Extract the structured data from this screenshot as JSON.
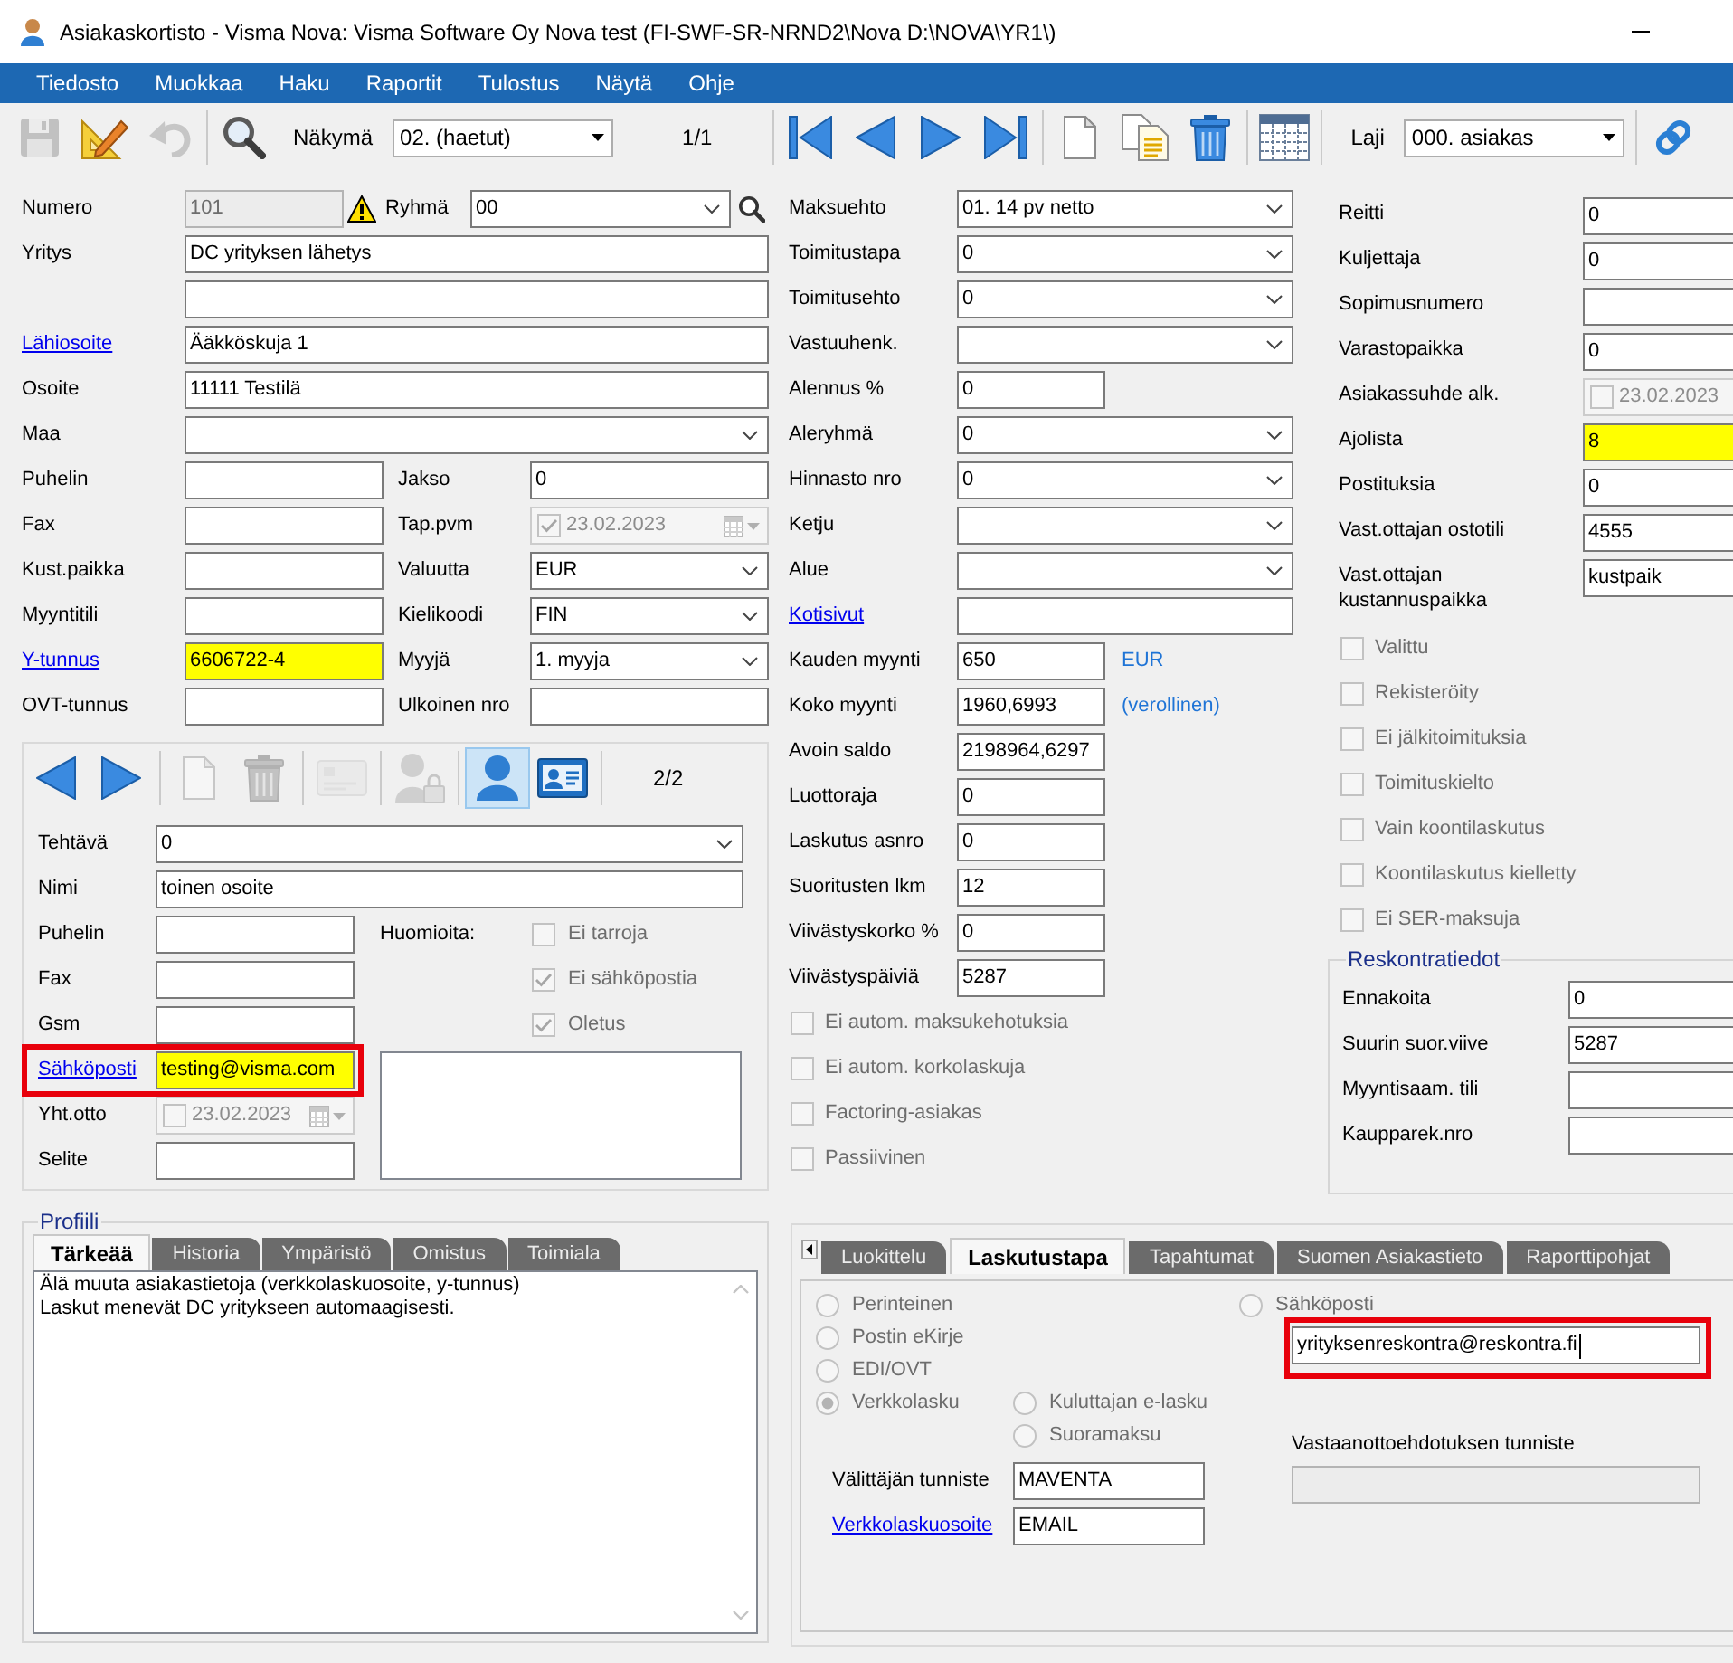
{
  "window": {
    "title": "Asiakaskortisto - Visma Nova: Visma Software Oy Nova test (FI-SWF-SR-NRND2\\Nova D:\\NOVA\\YR1\\)"
  },
  "menu": [
    "Tiedosto",
    "Muokkaa",
    "Haku",
    "Raportit",
    "Tulostus",
    "Näytä",
    "Ohje"
  ],
  "toolbar": [
    [
      {
        "kind": "save",
        "disabled": true
      },
      {
        "kind": "edit",
        "disabled": false
      },
      {
        "kind": "undo",
        "disabled": true
      }
    ],
    [
      {
        "kind": "search",
        "disabled": false
      },
      {
        "kind": "label",
        "text": "Näkymä"
      },
      {
        "kind": "dropdown",
        "value": "02. (haetut)"
      },
      {
        "kind": "counter",
        "text": "1/1"
      }
    ],
    [
      {
        "kind": "first",
        "disabled": false
      },
      {
        "kind": "previous",
        "disabled": false
      },
      {
        "kind": "next",
        "disabled": false
      },
      {
        "kind": "last",
        "disabled": false
      }
    ],
    [
      {
        "kind": "new",
        "disabled": false
      },
      {
        "kind": "copy",
        "disabled": false
      },
      {
        "kind": "delete",
        "disabled": false
      }
    ],
    [
      {
        "kind": "columns",
        "disabled": false
      }
    ],
    [
      {
        "kind": "label",
        "text": "Laji"
      },
      {
        "kind": "dropdown",
        "value": "000. asiakas"
      }
    ],
    [
      {
        "kind": "link",
        "disabled": false
      }
    ]
  ],
  "customer_rows": [
    [
      {
        "label": "Numero",
        "kind": "text",
        "value": "101",
        "disabled": true,
        "warning": true
      },
      {
        "label": "Ryhmä",
        "kind": "dropdown",
        "value": "00",
        "lookup": true
      }
    ],
    [
      {
        "label": "Yritys",
        "kind": "text",
        "value": "DC yrityksen lähetys"
      }
    ],
    [
      {
        "kind": "text"
      }
    ],
    [
      {
        "label": "Lähiosoite",
        "link": true,
        "kind": "text",
        "value": "Ääkköskuja 1"
      }
    ],
    [
      {
        "label": "Osoite",
        "kind": "text",
        "value": "11111 Testilä"
      }
    ],
    [
      {
        "label": "Maa",
        "kind": "dropdown"
      }
    ],
    [
      {
        "label": "Puhelin",
        "kind": "text"
      },
      {
        "label": "Jakso",
        "kind": "text",
        "value": "0"
      }
    ],
    [
      {
        "label": "Fax",
        "kind": "text"
      },
      {
        "label": "Tap.pvm",
        "kind": "date",
        "value": "23.02.2023",
        "checked": true,
        "disabled": true
      }
    ],
    [
      {
        "label": "Kust.paikka",
        "kind": "text"
      },
      {
        "label": "Valuutta",
        "kind": "dropdown",
        "value": "EUR"
      }
    ],
    [
      {
        "label": "Myyntitili",
        "kind": "text"
      },
      {
        "label": "Kielikoodi",
        "kind": "dropdown",
        "value": "FIN"
      }
    ],
    [
      {
        "label": "Y-tunnus",
        "link": true,
        "kind": "text",
        "value": "6606722-4",
        "highlighted": true
      },
      {
        "label": "Myyjä",
        "kind": "dropdown",
        "value": "1. myyja"
      }
    ],
    [
      {
        "label": "OVT-tunnus",
        "kind": "text"
      },
      {
        "label": "Ulkoinen nro",
        "kind": "text"
      }
    ]
  ],
  "contact": {
    "toolbar": [
      [
        {
          "kind": "previous",
          "disabled": false
        },
        {
          "kind": "next",
          "disabled": false
        }
      ],
      [
        {
          "kind": "new",
          "disabled": true
        },
        {
          "kind": "delete",
          "disabled": true
        }
      ],
      [
        {
          "kind": "card",
          "disabled": true
        }
      ],
      [
        {
          "kind": "permissions",
          "disabled": true
        }
      ],
      [
        {
          "kind": "contact",
          "disabled": false,
          "selected": true
        },
        {
          "kind": "vcard",
          "disabled": false,
          "selected": false
        }
      ],
      [
        {
          "kind": "counter",
          "text": "2/2"
        }
      ]
    ],
    "fields": [
      {
        "label": "Tehtävä",
        "kind": "dropdown",
        "value": "0"
      },
      {
        "label": "Nimi",
        "kind": "text",
        "value": "toinen osoite"
      }
    ],
    "details": [
      {
        "label": "Puhelin",
        "kind": "text"
      },
      {
        "label": "Fax",
        "kind": "text"
      },
      {
        "label": "Gsm",
        "kind": "text"
      },
      {
        "label": "Sähköposti",
        "link": true,
        "kind": "text",
        "value": "testing@visma.com",
        "highlighted": true,
        "outlined": true
      },
      {
        "label": "Yht.otto",
        "kind": "date",
        "value": "23.02.2023",
        "checked": false,
        "disabled": true
      },
      {
        "label": "Selite",
        "kind": "text"
      }
    ],
    "notes_label": "Huomioita:",
    "options": [
      {
        "label": "Ei tarroja",
        "checked": false,
        "disabled": true
      },
      {
        "label": "Ei sähköpostia",
        "checked": true,
        "disabled": true
      },
      {
        "label": "Oletus",
        "checked": true,
        "disabled": true
      }
    ]
  },
  "profile": {
    "title": "Profiili",
    "tabs": [
      {
        "label": "Tärkeää",
        "selected": true
      },
      {
        "label": "Historia",
        "selected": false
      },
      {
        "label": "Ympäristö",
        "selected": false
      },
      {
        "label": "Omistus",
        "selected": false
      },
      {
        "label": "Toimiala",
        "selected": false
      }
    ],
    "lines": [
      "Älä muuta asiakastietoja (verkkolaskuosoite, y-tunnus)",
      "Laskut menevät DC yritykseen automaagisesti."
    ]
  },
  "terms_fields": [
    {
      "label": "Maksuehto",
      "kind": "dropdown",
      "value": "01. 14 pv netto"
    },
    {
      "label": "Toimitustapa",
      "kind": "dropdown",
      "value": "0"
    },
    {
      "label": "Toimitusehto",
      "kind": "dropdown",
      "value": "0"
    },
    {
      "label": "Vastuuhenk.",
      "kind": "dropdown"
    },
    {
      "label": "Alennus %",
      "kind": "number",
      "value": "0"
    },
    {
      "label": "Aleryhmä",
      "kind": "dropdown",
      "value": "0"
    },
    {
      "label": "Hinnasto nro",
      "kind": "dropdown",
      "value": "0"
    },
    {
      "label": "Ketju",
      "kind": "dropdown"
    },
    {
      "label": "Alue",
      "kind": "dropdown"
    },
    {
      "label": "Kotisivut",
      "link": true,
      "kind": "text"
    },
    {
      "label": "Kauden myynti",
      "kind": "number",
      "value": "650",
      "suffix": "EUR"
    },
    {
      "label": "Koko myynti",
      "kind": "number",
      "value": "1960,6993",
      "suffix": "(verollinen)"
    },
    {
      "label": "Avoin saldo",
      "kind": "number",
      "value": "2198964,6297"
    },
    {
      "label": "Luottoraja",
      "kind": "number",
      "value": "0"
    },
    {
      "label": "Laskutus asnro",
      "kind": "number",
      "value": "0"
    },
    {
      "label": "Suoritusten lkm",
      "kind": "number",
      "value": "12"
    },
    {
      "label": "Viivästyskorko %",
      "kind": "number",
      "value": "0"
    },
    {
      "label": "Viivästyspäiviä",
      "kind": "number",
      "value": "5287"
    }
  ],
  "terms_options": [
    {
      "label": "Ei autom. maksukehotuksia",
      "checked": false,
      "disabled": true
    },
    {
      "label": "Ei autom. korkolaskuja",
      "checked": false,
      "disabled": true
    },
    {
      "label": "Factoring-asiakas",
      "checked": false,
      "disabled": true
    },
    {
      "label": "Passiivinen",
      "checked": false,
      "disabled": true
    }
  ],
  "other_fields": [
    {
      "label": "Reitti",
      "kind": "text",
      "value": "0"
    },
    {
      "label": "Kuljettaja",
      "kind": "text",
      "value": "0"
    },
    {
      "label": "Sopimusnumero",
      "kind": "text"
    },
    {
      "label": "Varastopaikka",
      "kind": "text",
      "value": "0"
    },
    {
      "label": "Asiakassuhde alk.",
      "kind": "date",
      "value": "23.02.2023",
      "checked": false,
      "disabled": true
    },
    {
      "label": "Ajolista",
      "kind": "text",
      "value": "8",
      "highlighted": true
    },
    {
      "label": "Postituksia",
      "kind": "text",
      "value": "0"
    },
    {
      "label": "Vast.ottajan ostotili",
      "kind": "text",
      "value": "4555"
    },
    {
      "label": "Vast.ottajan kustannuspaikka",
      "kind": "text",
      "value": "kustpaik"
    }
  ],
  "other_options": [
    {
      "label": "Valittu",
      "checked": false,
      "disabled": true
    },
    {
      "label": "Rekisteröity",
      "checked": false,
      "disabled": true
    },
    {
      "label": "Ei jälkitoimituksia",
      "checked": false,
      "disabled": true
    },
    {
      "label": "Toimituskielto",
      "checked": false,
      "disabled": true
    },
    {
      "label": "Vain koontilaskutus",
      "checked": false,
      "disabled": true
    },
    {
      "label": "Koontilaskutus kielletty",
      "checked": false,
      "disabled": true
    },
    {
      "label": "Ei SER-maksuja",
      "checked": false,
      "disabled": true
    }
  ],
  "ledger": {
    "title": "Reskontratiedot",
    "fields": [
      {
        "label": "Ennakoita",
        "kind": "text",
        "value": "0"
      },
      {
        "label": "Suurin suor.viive",
        "kind": "text",
        "value": "5287"
      },
      {
        "label": "Myyntisaam. tili",
        "kind": "text"
      },
      {
        "label": "Kaupparek.nro",
        "kind": "text"
      }
    ]
  },
  "billing": {
    "tabs": [
      {
        "label": "Luokittelu",
        "selected": false
      },
      {
        "label": "Laskutustapa",
        "selected": true
      },
      {
        "label": "Tapahtumat",
        "selected": false
      },
      {
        "label": "Suomen Asiakastieto",
        "selected": false
      },
      {
        "label": "Raporttipohjat",
        "selected": false
      }
    ],
    "methods": [
      {
        "label": "Perinteinen",
        "selected": false,
        "disabled": true
      },
      {
        "label": "Postin eKirje",
        "selected": false,
        "disabled": true
      },
      {
        "label": "EDI/OVT",
        "selected": false,
        "disabled": true
      },
      {
        "label": "Verkkolasku",
        "selected": true,
        "disabled": true,
        "children": [
          {
            "label": "Kuluttajan e-lasku",
            "selected": false,
            "disabled": true
          },
          {
            "label": "Suoramaksu",
            "selected": false,
            "disabled": true
          }
        ]
      }
    ],
    "email_option": {
      "label": "Sähköposti",
      "selected": false,
      "disabled": true
    },
    "email_address": {
      "value": "yrityksenreskontra@reskontra.fi",
      "outlined": true,
      "focused": true
    },
    "fields": [
      {
        "label": "Välittäjän tunniste",
        "kind": "text",
        "value": "MAVENTA"
      },
      {
        "label": "Verkkolaskuosoite",
        "link": true,
        "kind": "text",
        "value": "EMAIL"
      }
    ],
    "proposal": {
      "label": "Vastaanottoehdotuksen tunniste",
      "disabled": true
    }
  }
}
